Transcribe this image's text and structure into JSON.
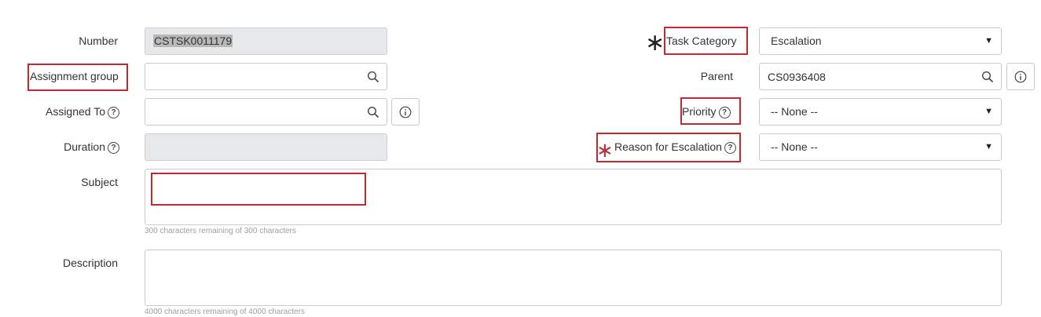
{
  "colors": {
    "annotation_red": "#c6282d",
    "readonly_bg": "#e6e8ea",
    "mandatory_dark": "#222222",
    "mandatory_red": "#b5323a"
  },
  "left": {
    "number": {
      "label": "Number",
      "value": "CSTSK0011179"
    },
    "assignment_group": {
      "label": "Assignment group",
      "value": ""
    },
    "assigned_to": {
      "label": "Assigned To",
      "value": ""
    },
    "duration": {
      "label": "Duration",
      "value": ""
    }
  },
  "right": {
    "task_category": {
      "label": "Task Category",
      "value": "Escalation"
    },
    "parent": {
      "label": "Parent",
      "value": "CS0936408"
    },
    "priority": {
      "label": "Priority",
      "value": "-- None --"
    },
    "reason": {
      "label": "Reason for Escalation",
      "value": "-- None --"
    }
  },
  "subject": {
    "label": "Subject",
    "hint": "300 characters remaining of 300 characters"
  },
  "description": {
    "label": "Description",
    "hint": "4000 characters remaining of 4000 characters"
  },
  "glyphs": {
    "mandatory": "∗",
    "caret": "▼",
    "help": "?"
  },
  "icons": {
    "search": "search-icon",
    "info": "info-icon",
    "help": "help-icon",
    "caret": "caret-down-icon"
  }
}
